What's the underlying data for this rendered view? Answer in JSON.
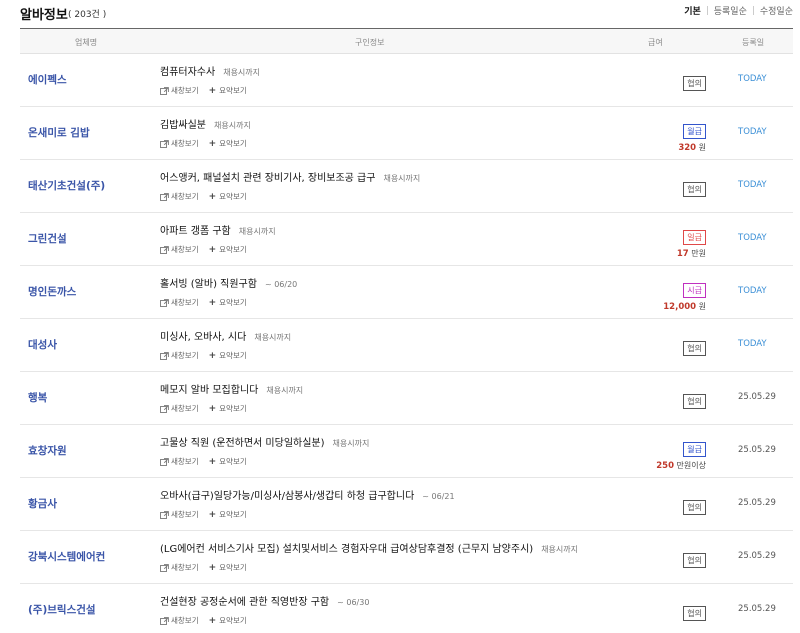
{
  "header": {
    "title": "알바정보",
    "count": "( 203건 )",
    "sort": [
      "기본",
      "등록일순",
      "수정일순"
    ]
  },
  "table": {
    "columns": [
      "업체명",
      "구인정보",
      "급여",
      "등록일"
    ]
  },
  "actions": {
    "new_window": "새창보기",
    "summary": "요약보기"
  },
  "colors": {
    "company": "#3a55a8",
    "today": "#3b8fd6",
    "amount": "#c0392b",
    "monthly": "#3355cc",
    "daily": "#e04848",
    "hourly": "#c030c0"
  },
  "rows": [
    {
      "company": "에이펙스",
      "title": "컴퓨터자수사",
      "deadline": "채용시까지",
      "pay_type": "협의",
      "pay_color": "#555555",
      "amount": "",
      "unit": "",
      "date": "TODAY",
      "today": true
    },
    {
      "company": "온새미로 김밥",
      "title": "김밥싸실분",
      "deadline": "채용시까지",
      "pay_type": "월급",
      "pay_color": "#3355cc",
      "amount": "320",
      "unit": "원",
      "date": "TODAY",
      "today": true
    },
    {
      "company": "태산기초건설(주)",
      "title": "어스앵커, 패널설치 관련 장비기사, 장비보조공 급구",
      "deadline": "채용시까지",
      "pay_type": "협의",
      "pay_color": "#555555",
      "amount": "",
      "unit": "",
      "date": "TODAY",
      "today": true
    },
    {
      "company": "그린건설",
      "title": "아파트 갱폼 구함",
      "deadline": "채용시까지",
      "pay_type": "일급",
      "pay_color": "#e04848",
      "amount": "17",
      "unit": "만원",
      "date": "TODAY",
      "today": true
    },
    {
      "company": "명인돈까스",
      "title": "홀서빙 (알바) 직원구함",
      "deadline": "~ 06/20",
      "pay_type": "시급",
      "pay_color": "#c030c0",
      "amount": "12,000",
      "unit": "원",
      "date": "TODAY",
      "today": true
    },
    {
      "company": "대성사",
      "title": "미싱사, 오바사, 시다",
      "deadline": "채용시까지",
      "pay_type": "협의",
      "pay_color": "#555555",
      "amount": "",
      "unit": "",
      "date": "TODAY",
      "today": true
    },
    {
      "company": "행복",
      "title": "메모지 알바 모집합니다",
      "deadline": "채용시까지",
      "pay_type": "협의",
      "pay_color": "#555555",
      "amount": "",
      "unit": "",
      "date": "25.05.29",
      "today": false
    },
    {
      "company": "효창자원",
      "title": "고물상 직원 (운전하면서 미당일하실분)",
      "deadline": "채용시까지",
      "pay_type": "월급",
      "pay_color": "#3355cc",
      "amount": "250",
      "unit": "만원이상",
      "date": "25.05.29",
      "today": false
    },
    {
      "company": "황금사",
      "title": "오바사(급구)일당가능/미싱사/삼봉사/생갑티 하청 급구합니다",
      "deadline": "~ 06/21",
      "pay_type": "협의",
      "pay_color": "#555555",
      "amount": "",
      "unit": "",
      "date": "25.05.29",
      "today": false
    },
    {
      "company": "강북시스템에어컨",
      "title": "(LG에어컨 서비스기사 모집) 설치및서비스 경험자우대 급여상담후결정 (근무지 남양주시)",
      "deadline": "채용시까지",
      "pay_type": "협의",
      "pay_color": "#555555",
      "amount": "",
      "unit": "",
      "date": "25.05.29",
      "today": false
    },
    {
      "company": "(주)브릭스건설",
      "title": "건설현장 공정순서에 관한 직영반장 구함",
      "deadline": "~ 06/30",
      "pay_type": "협의",
      "pay_color": "#555555",
      "amount": "",
      "unit": "",
      "date": "25.05.29",
      "today": false
    }
  ]
}
